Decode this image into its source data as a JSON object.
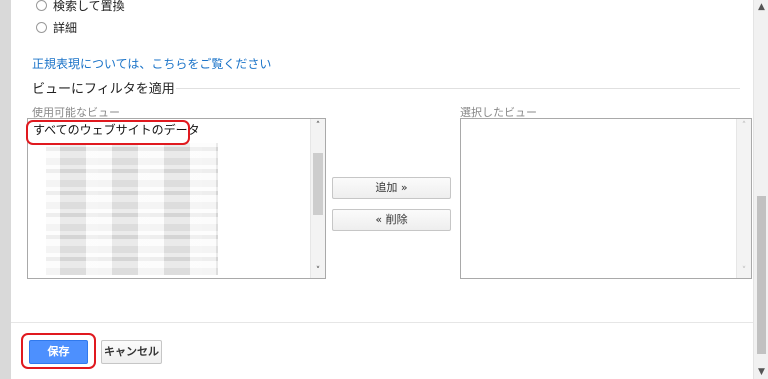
{
  "options": {
    "search_replace": "検索して置換",
    "advanced": "詳細"
  },
  "regex_link": "正規表現については、こちらをご覧ください",
  "apply_section": {
    "title": "ビューにフィルタを適用",
    "available_label": "使用可能なビュー",
    "selected_label": "選択したビュー",
    "available_items": [
      "すべてのウェブサイトのデータ"
    ],
    "add_button": "追加 »",
    "remove_button": "« 削除"
  },
  "footer": {
    "save": "保存",
    "cancel": "キャンセル"
  },
  "colors": {
    "link": "#1a73c8",
    "primary_button": "#4d90fe",
    "highlight": "#e0191f"
  }
}
